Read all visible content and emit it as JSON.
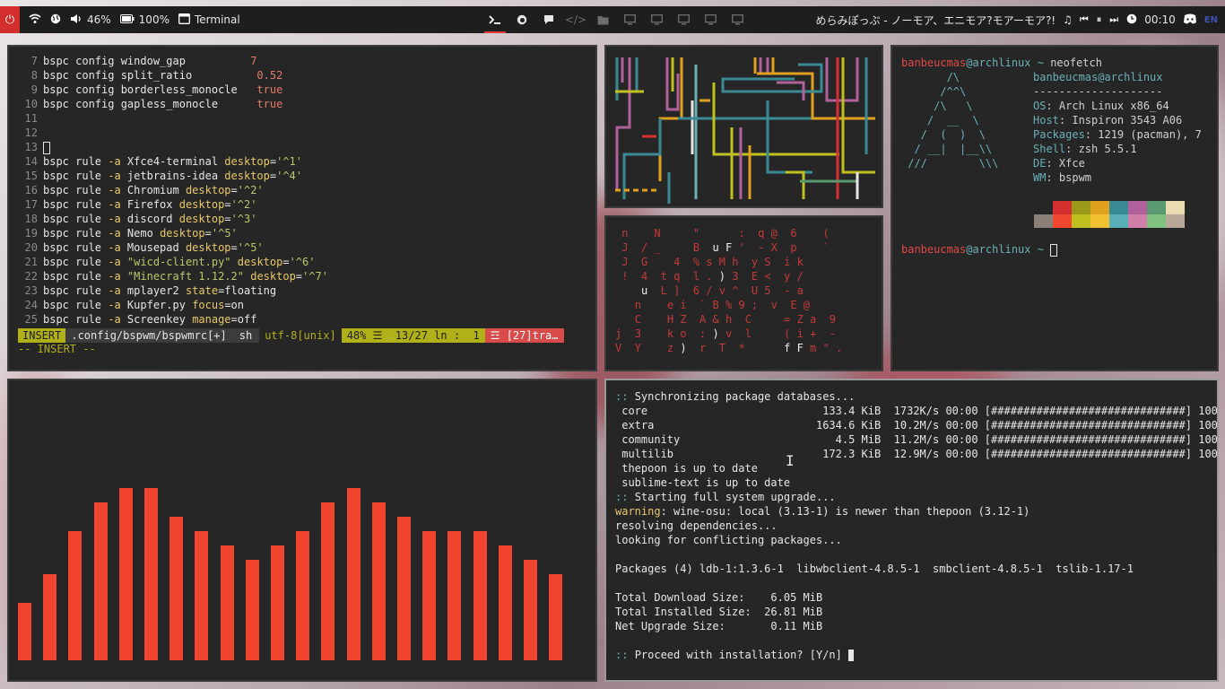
{
  "topbar": {
    "volume": "46%",
    "battery": "100%",
    "active_window": "Terminal",
    "media_title": "めらみぽっぷ - ノーモア、エニモア?モアーモア?!",
    "time": "00:10",
    "lang": "EN",
    "icons": [
      "power-icon",
      "wifi-icon",
      "globe-icon",
      "speaker-icon",
      "battery-icon",
      "window-icon"
    ],
    "workspaces": [
      "terminal",
      "firefox",
      "chat",
      "code",
      "folder",
      "monitor",
      "monitor",
      "monitor",
      "monitor",
      "monitor"
    ]
  },
  "vim": {
    "lines": [
      {
        "n": "7",
        "parts": [
          [
            "kw",
            "bspc config window_gap          "
          ],
          [
            "val",
            "7"
          ]
        ]
      },
      {
        "n": "8",
        "parts": [
          [
            "kw",
            "bspc config split_ratio          "
          ],
          [
            "val",
            "0.52"
          ]
        ]
      },
      {
        "n": "9",
        "parts": [
          [
            "kw",
            "bspc config borderless_monocle   "
          ],
          [
            "val",
            "true"
          ]
        ]
      },
      {
        "n": "10",
        "parts": [
          [
            "kw",
            "bspc config gapless_monocle      "
          ],
          [
            "val",
            "true"
          ]
        ]
      },
      {
        "n": "11",
        "parts": []
      },
      {
        "n": "12",
        "parts": []
      },
      {
        "n": "13",
        "parts": [
          [
            "cursor",
            ""
          ]
        ]
      },
      {
        "n": "14",
        "parts": [
          [
            "kw",
            "bspc rule "
          ],
          [
            "opt",
            "-a"
          ],
          [
            "kw",
            " Xfce4-terminal "
          ],
          [
            "opt",
            "desktop"
          ],
          [
            "kw",
            "="
          ],
          [
            "str",
            "'^1'"
          ]
        ]
      },
      {
        "n": "15",
        "parts": [
          [
            "kw",
            "bspc rule "
          ],
          [
            "opt",
            "-a"
          ],
          [
            "kw",
            " jetbrains-idea "
          ],
          [
            "opt",
            "desktop"
          ],
          [
            "kw",
            "="
          ],
          [
            "str",
            "'^4'"
          ]
        ]
      },
      {
        "n": "16",
        "parts": [
          [
            "kw",
            "bspc rule "
          ],
          [
            "opt",
            "-a"
          ],
          [
            "kw",
            " Chromium "
          ],
          [
            "opt",
            "desktop"
          ],
          [
            "kw",
            "="
          ],
          [
            "str",
            "'^2'"
          ]
        ]
      },
      {
        "n": "17",
        "parts": [
          [
            "kw",
            "bspc rule "
          ],
          [
            "opt",
            "-a"
          ],
          [
            "kw",
            " Firefox "
          ],
          [
            "opt",
            "desktop"
          ],
          [
            "kw",
            "="
          ],
          [
            "str",
            "'^2'"
          ]
        ]
      },
      {
        "n": "18",
        "parts": [
          [
            "kw",
            "bspc rule "
          ],
          [
            "opt",
            "-a"
          ],
          [
            "kw",
            " discord "
          ],
          [
            "opt",
            "desktop"
          ],
          [
            "kw",
            "="
          ],
          [
            "str",
            "'^3'"
          ]
        ]
      },
      {
        "n": "19",
        "parts": [
          [
            "kw",
            "bspc rule "
          ],
          [
            "opt",
            "-a"
          ],
          [
            "kw",
            " Nemo "
          ],
          [
            "opt",
            "desktop"
          ],
          [
            "kw",
            "="
          ],
          [
            "str",
            "'^5'"
          ]
        ]
      },
      {
        "n": "20",
        "parts": [
          [
            "kw",
            "bspc rule "
          ],
          [
            "opt",
            "-a"
          ],
          [
            "kw",
            " Mousepad "
          ],
          [
            "opt",
            "desktop"
          ],
          [
            "kw",
            "="
          ],
          [
            "str",
            "'^5'"
          ]
        ]
      },
      {
        "n": "21",
        "parts": [
          [
            "kw",
            "bspc rule "
          ],
          [
            "opt",
            "-a"
          ],
          [
            "str",
            " \"wicd-client.py\""
          ],
          [
            "kw",
            " "
          ],
          [
            "opt",
            "desktop"
          ],
          [
            "kw",
            "="
          ],
          [
            "str",
            "'^6'"
          ]
        ]
      },
      {
        "n": "22",
        "parts": [
          [
            "kw",
            "bspc rule "
          ],
          [
            "opt",
            "-a"
          ],
          [
            "str",
            " \"Minecraft 1.12.2\""
          ],
          [
            "kw",
            " "
          ],
          [
            "opt",
            "desktop"
          ],
          [
            "kw",
            "="
          ],
          [
            "str",
            "'^7'"
          ]
        ]
      },
      {
        "n": "23",
        "parts": [
          [
            "kw",
            "bspc rule "
          ],
          [
            "opt",
            "-a"
          ],
          [
            "kw",
            " mplayer2 "
          ],
          [
            "opt",
            "state"
          ],
          [
            "kw",
            "=floating"
          ]
        ]
      },
      {
        "n": "24",
        "parts": [
          [
            "kw",
            "bspc rule "
          ],
          [
            "opt",
            "-a"
          ],
          [
            "kw",
            " Kupfer.py "
          ],
          [
            "opt",
            "focus"
          ],
          [
            "kw",
            "=on"
          ]
        ]
      },
      {
        "n": "25",
        "parts": [
          [
            "kw",
            "bspc rule "
          ],
          [
            "opt",
            "-a"
          ],
          [
            "kw",
            " Screenkey "
          ],
          [
            "opt",
            "manage"
          ],
          [
            "kw",
            "=off"
          ]
        ]
      }
    ],
    "status": {
      "mode": "INSERT",
      "file": ".config/bspwm/bspwmrc[+]",
      "filetype": "sh",
      "encoding": "utf-8[unix]",
      "position": "48% ☰  13/27 ln :  1",
      "errors": "☲ [27]tra…"
    },
    "mode_msg": "-- INSERT --"
  },
  "cmatrix": {
    "rows": [
      " n    N     \"      :  q @  6    (",
      " J  / _     B  u F '  - X  p    `",
      " J  G    4  % s M h  y S  i k",
      " !  4  t q  l . ) 3  E <  y /",
      "    u  L ]  6 / v ^  U 5  - a",
      "   n    e i  ` B % 9 ;  v  E @",
      "   C    H Z  A & h  C     = Z a  9",
      "j  3    k o  : ) v  l     ( i +  -",
      "V  Y    z )  r  T  *      f F m \" ."
    ]
  },
  "neofetch": {
    "prompt_user": "banbeucmas",
    "prompt_host": "@archlinux",
    "prompt_sym": " ~ ",
    "command": "neofetch",
    "header_user": "banbeucmas",
    "header_host": "@archlinux",
    "separator": "--------------------",
    "logo": [
      "       /\\",
      "      /^^\\",
      "     /\\   \\",
      "    /  __  \\",
      "   /  (  )  \\",
      "  / __|  |__\\\\",
      " ///        \\\\\\"
    ],
    "info": [
      [
        "OS",
        ": Arch Linux x86_64"
      ],
      [
        "Host",
        ": Inspiron 3543 A06"
      ],
      [
        "Packages",
        ": 1219 (pacman), 7"
      ],
      [
        "Shell",
        ": zsh 5.5.1"
      ],
      [
        "DE",
        ": Xfce"
      ],
      [
        "WM",
        ": bspwm"
      ]
    ],
    "palette": [
      "#262626",
      "#d32f2f",
      "#9a9a18",
      "#e0a020",
      "#3a8a94",
      "#b0609a",
      "#5a9a70",
      "#e8dcb0",
      "#8a8078",
      "#f04830",
      "#c0c020",
      "#f0c030",
      "#5ab0b8",
      "#d080a8",
      "#80c080",
      "#b8a898"
    ]
  },
  "visualizer": {
    "levels": [
      64,
      96,
      144,
      176,
      192,
      192,
      160,
      144,
      128,
      112,
      128,
      144,
      176,
      192,
      176,
      160,
      144,
      144,
      144,
      128,
      112,
      96
    ]
  },
  "pacman": {
    "lines": [
      [
        [
          "blue",
          ":: "
        ],
        [
          "kw",
          "Synchronizing package databases..."
        ]
      ],
      [
        [
          "kw",
          " core                           133.4 KiB  1732K/s 00:00 [##############################] 100%"
        ]
      ],
      [
        [
          "kw",
          " extra                         1634.6 KiB  10.2M/s 00:00 [##############################] 100%"
        ]
      ],
      [
        [
          "kw",
          " community                        4.5 MiB  11.2M/s 00:00 [##############################] 100%"
        ]
      ],
      [
        [
          "kw",
          " multilib                       172.3 KiB  12.9M/s 00:00 [##############################] 100%"
        ]
      ],
      [
        [
          "kw",
          " thepoon is up to date"
        ]
      ],
      [
        [
          "kw",
          " sublime-text is up to date"
        ]
      ],
      [
        [
          "blue",
          ":: "
        ],
        [
          "kw",
          "Starting full system upgrade..."
        ]
      ],
      [
        [
          "yel",
          "warning"
        ],
        [
          "kw",
          ": wine-osu: local (3.13-1) is newer than thepoon (3.12-1)"
        ]
      ],
      [
        [
          "kw",
          "resolving dependencies..."
        ]
      ],
      [
        [
          "kw",
          "looking for conflicting packages..."
        ]
      ],
      [
        [
          "kw",
          ""
        ]
      ],
      [
        [
          "kw",
          "Packages (4) ldb-1:1.3.6-1  libwbclient-4.8.5-1  smbclient-4.8.5-1  tslib-1.17-1"
        ]
      ],
      [
        [
          "kw",
          ""
        ]
      ],
      [
        [
          "kw",
          "Total Download Size:    6.05 MiB"
        ]
      ],
      [
        [
          "kw",
          "Total Installed Size:  26.81 MiB"
        ]
      ],
      [
        [
          "kw",
          "Net Upgrade Size:       0.11 MiB"
        ]
      ],
      [
        [
          "kw",
          ""
        ]
      ],
      [
        [
          "blue",
          ":: "
        ],
        [
          "kw",
          "Proceed with installation? [Y/n] "
        ],
        [
          "cursor",
          ""
        ]
      ]
    ]
  }
}
